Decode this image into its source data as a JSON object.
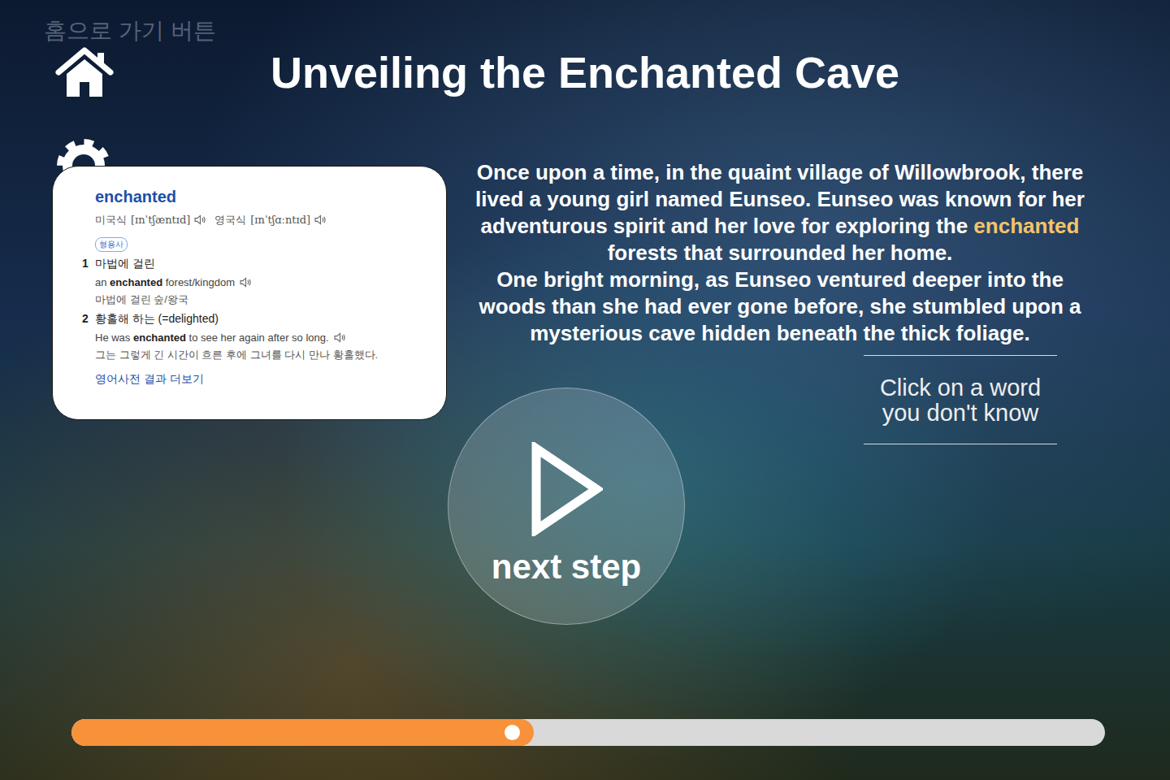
{
  "header": {
    "home_label": "홈으로 가기 버튼",
    "title": "Unveiling the Enchanted Cave"
  },
  "dictionary_popup": {
    "word": "enchanted",
    "pronunciations": [
      {
        "region": "미국식",
        "ipa": "[ɪnˈtʃæntɪd]"
      },
      {
        "region": "영국식",
        "ipa": "[ɪnˈtʃɑːntɪd]"
      }
    ],
    "part_of_speech": "형용사",
    "senses": [
      {
        "number": "1",
        "meaning": "마법에 걸린",
        "example_before": "an ",
        "example_keyword": "enchanted",
        "example_after": " forest/kingdom",
        "translation": "마법에 걸린 숲/왕국"
      },
      {
        "number": "2",
        "meaning": "황홀해 하는 (=delighted)",
        "example_before": "He was ",
        "example_keyword": "enchanted",
        "example_after": " to see her again after so long.",
        "translation": "그는 그렇게 긴 시간이 흐른 후에 그녀를 다시 만나 황홀했다."
      }
    ],
    "more_link": "영어사전 결과 더보기"
  },
  "story": {
    "paragraphs": [
      [
        {
          "text": "Once upon a time, in the quaint village of Willowbrook, there lived a young girl named Eunseo. Eunseo was known for her adventurous spirit and her love for exploring the ",
          "highlighted": false
        },
        {
          "text": "enchanted",
          "highlighted": true
        },
        {
          "text": " forests that surrounded her home.",
          "highlighted": false
        }
      ],
      [
        {
          "text": "One bright morning, as Eunseo ventured deeper into the woods than she had ever gone before, she stumbled upon a mysterious cave hidden beneath the thick foliage.",
          "highlighted": false
        }
      ]
    ]
  },
  "hint": "Click on a word you don't know",
  "next_button": {
    "label": "next step"
  },
  "progress": {
    "level": 0.447
  }
}
